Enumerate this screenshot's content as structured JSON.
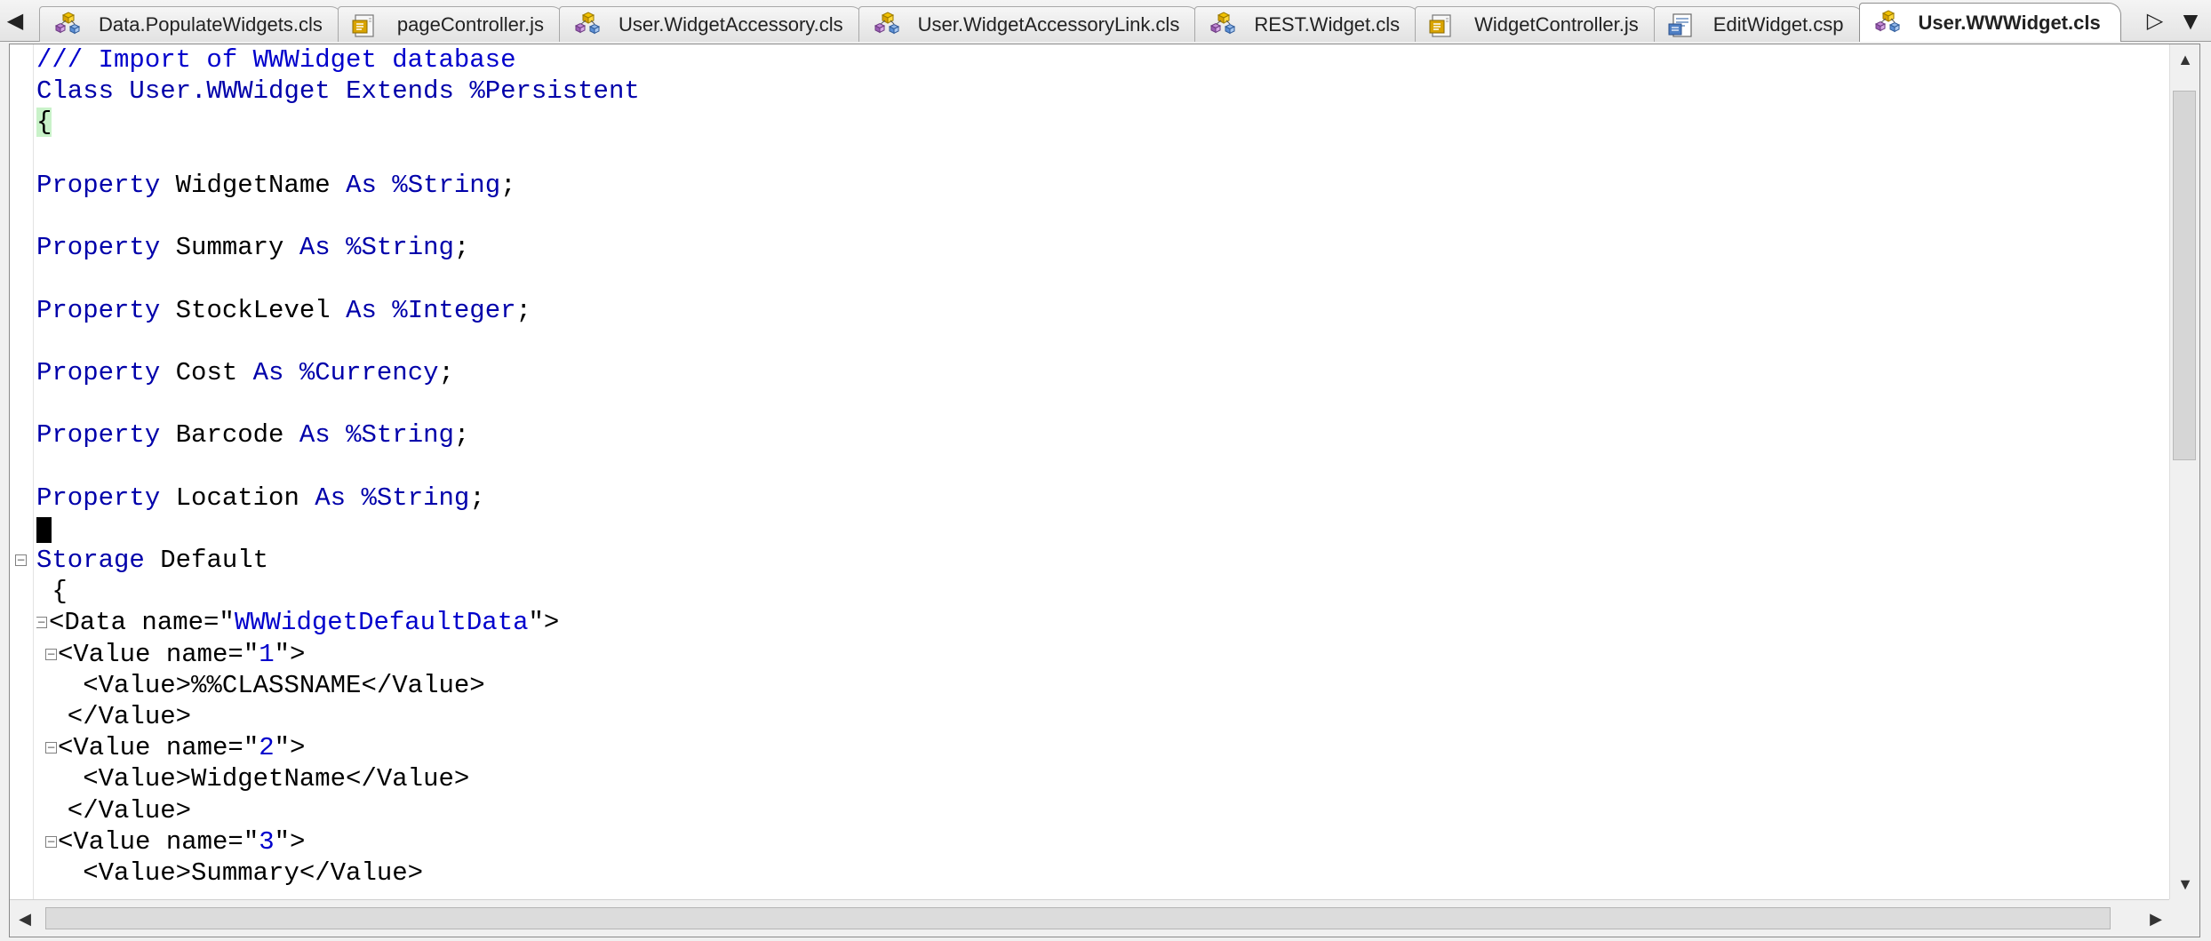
{
  "tabs": [
    {
      "label": "Data.PopulateWidgets.cls",
      "icon": "class-icon",
      "active": false
    },
    {
      "label": "pageController.js",
      "icon": "js-file-icon",
      "active": false
    },
    {
      "label": "User.WidgetAccessory.cls",
      "icon": "class-icon",
      "active": false
    },
    {
      "label": "User.WidgetAccessoryLink.cls",
      "icon": "class-icon",
      "active": false
    },
    {
      "label": "REST.Widget.cls",
      "icon": "class-icon",
      "active": false
    },
    {
      "label": "WidgetController.js",
      "icon": "js-file-icon",
      "active": false
    },
    {
      "label": "EditWidget.csp",
      "icon": "csp-page-icon",
      "active": false
    },
    {
      "label": "User.WWWidget.cls",
      "icon": "class-icon",
      "active": true
    }
  ],
  "tabbar": {
    "scroll_left_icon": "◀",
    "scroll_right_icon": "▷",
    "close_icon": "▼"
  },
  "code": {
    "lines": [
      {
        "spans": [
          {
            "t": "/// Import of WWWidget database",
            "c": "comment"
          }
        ]
      },
      {
        "spans": [
          {
            "t": "Class ",
            "c": "kw"
          },
          {
            "t": "User.WWWidget",
            "c": "kw"
          },
          {
            "t": " Extends ",
            "c": "kw"
          },
          {
            "t": "%Persistent",
            "c": "kw"
          }
        ]
      },
      {
        "spans": [
          {
            "t": "{",
            "c": "brace-hl"
          }
        ]
      },
      {
        "spans": []
      },
      {
        "spans": [
          {
            "t": "Property",
            "c": "kw"
          },
          {
            "t": " WidgetName ",
            "c": ""
          },
          {
            "t": "As",
            "c": "kw"
          },
          {
            "t": " ",
            "c": ""
          },
          {
            "t": "%String",
            "c": "kw"
          },
          {
            "t": ";",
            "c": ""
          }
        ]
      },
      {
        "spans": []
      },
      {
        "spans": [
          {
            "t": "Property",
            "c": "kw"
          },
          {
            "t": " Summary ",
            "c": ""
          },
          {
            "t": "As",
            "c": "kw"
          },
          {
            "t": " ",
            "c": ""
          },
          {
            "t": "%String",
            "c": "kw"
          },
          {
            "t": ";",
            "c": ""
          }
        ]
      },
      {
        "spans": []
      },
      {
        "spans": [
          {
            "t": "Property",
            "c": "kw"
          },
          {
            "t": " StockLevel ",
            "c": ""
          },
          {
            "t": "As",
            "c": "kw"
          },
          {
            "t": " ",
            "c": ""
          },
          {
            "t": "%Integer",
            "c": "kw"
          },
          {
            "t": ";",
            "c": ""
          }
        ]
      },
      {
        "spans": []
      },
      {
        "spans": [
          {
            "t": "Property",
            "c": "kw"
          },
          {
            "t": " Cost ",
            "c": ""
          },
          {
            "t": "As",
            "c": "kw"
          },
          {
            "t": " ",
            "c": ""
          },
          {
            "t": "%Currency",
            "c": "kw"
          },
          {
            "t": ";",
            "c": ""
          }
        ]
      },
      {
        "spans": []
      },
      {
        "spans": [
          {
            "t": "Property",
            "c": "kw"
          },
          {
            "t": " Barcode ",
            "c": ""
          },
          {
            "t": "As",
            "c": "kw"
          },
          {
            "t": " ",
            "c": ""
          },
          {
            "t": "%String",
            "c": "kw"
          },
          {
            "t": ";",
            "c": ""
          }
        ]
      },
      {
        "spans": []
      },
      {
        "spans": [
          {
            "t": "Property",
            "c": "kw"
          },
          {
            "t": " Location ",
            "c": ""
          },
          {
            "t": "As",
            "c": "kw"
          },
          {
            "t": " ",
            "c": ""
          },
          {
            "t": "%String",
            "c": "kw"
          },
          {
            "t": ";",
            "c": ""
          }
        ]
      },
      {
        "spans": [],
        "cursor": true
      },
      {
        "spans": [
          {
            "t": "Storage",
            "c": "kw"
          },
          {
            "t": " Default",
            "c": ""
          }
        ],
        "fold": 0
      },
      {
        "spans": [
          {
            "t": " {",
            "c": ""
          }
        ]
      },
      {
        "spans": [
          {
            "t": "<Data name=\"",
            "c": ""
          },
          {
            "t": "WWWidgetDefaultData",
            "c": "str"
          },
          {
            "t": "\">",
            "c": ""
          }
        ],
        "indent": 1,
        "fold": 1
      },
      {
        "spans": [
          {
            "t": "<Value name=\"",
            "c": ""
          },
          {
            "t": "1",
            "c": "str"
          },
          {
            "t": "\">",
            "c": ""
          }
        ],
        "indent": 2,
        "fold": 2
      },
      {
        "spans": [
          {
            "t": "   <Value>%%CLASSNAME</Value>",
            "c": ""
          }
        ]
      },
      {
        "spans": [
          {
            "t": "  </Value>",
            "c": ""
          }
        ]
      },
      {
        "spans": [
          {
            "t": "<Value name=\"",
            "c": ""
          },
          {
            "t": "2",
            "c": "str"
          },
          {
            "t": "\">",
            "c": ""
          }
        ],
        "indent": 2,
        "fold": 2
      },
      {
        "spans": [
          {
            "t": "   <Value>WidgetName</Value>",
            "c": ""
          }
        ]
      },
      {
        "spans": [
          {
            "t": "  </Value>",
            "c": ""
          }
        ]
      },
      {
        "spans": [
          {
            "t": "<Value name=\"",
            "c": ""
          },
          {
            "t": "3",
            "c": "str"
          },
          {
            "t": "\">",
            "c": ""
          }
        ],
        "indent": 2,
        "fold": 2
      },
      {
        "spans": [
          {
            "t": "   <Value>Summary</Value>",
            "c": ""
          }
        ]
      }
    ]
  },
  "scroll": {
    "up_icon": "▲",
    "down_icon": "▼",
    "left_icon": "◀",
    "right_icon": "▶"
  },
  "colors": {
    "keyword": "#0000aa",
    "string": "#0000cc",
    "comment": "#0000cc",
    "brace_highlight": "#c9f2c9"
  }
}
